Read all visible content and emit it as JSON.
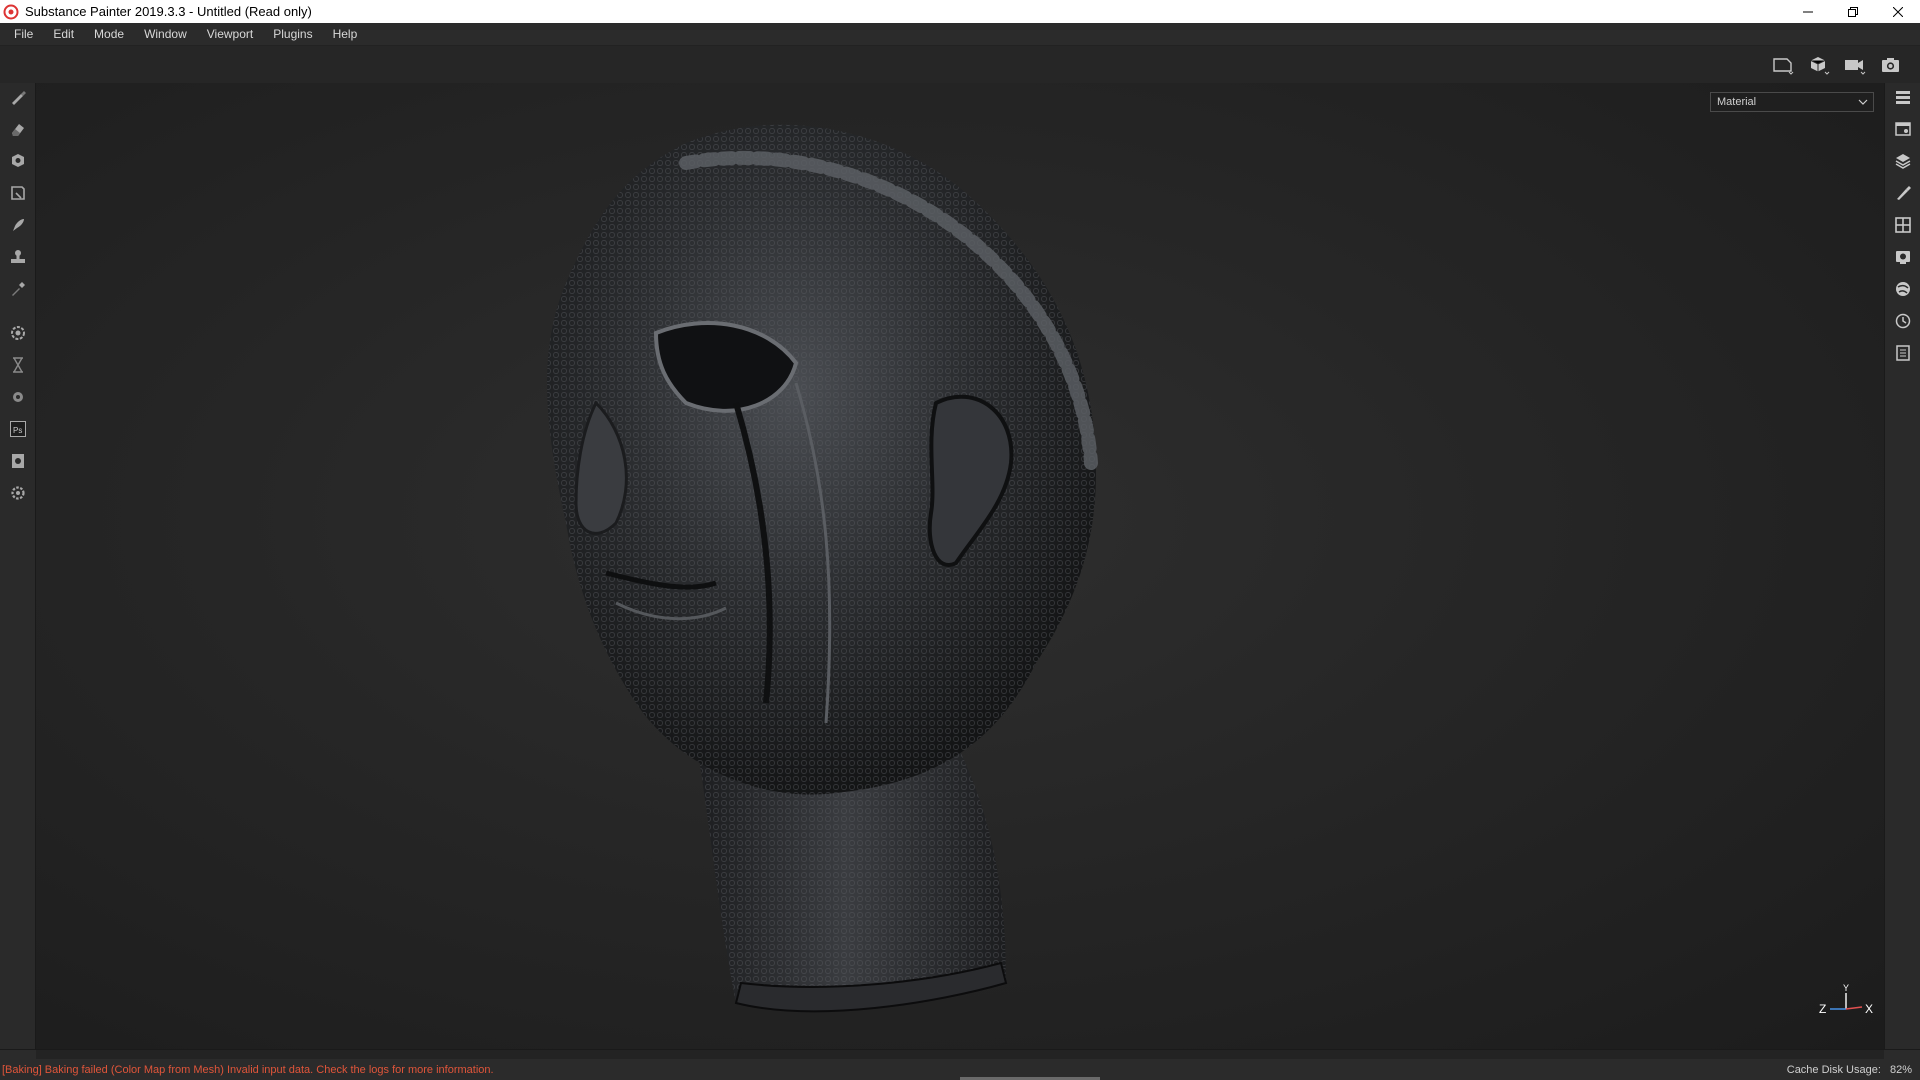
{
  "window": {
    "title": "Substance Painter 2019.3.3 - Untitled (Read only)",
    "minimize_icon": "minimize-icon",
    "restore_icon": "restore-icon",
    "close_icon": "close-icon"
  },
  "menu": {
    "items": [
      "File",
      "Edit",
      "Mode",
      "Window",
      "Viewport",
      "Plugins",
      "Help"
    ]
  },
  "viewport_toolbar": {
    "icons": [
      "2d-view-icon",
      "3d-view-icon",
      "camera-icon",
      "screenshot-icon"
    ]
  },
  "left_toolbar": {
    "icons": [
      "paint-brush-icon",
      "eraser-icon",
      "projection-icon",
      "polygon-fill-icon",
      "smudge-icon",
      "clone-stamp-icon",
      "color-picker-icon",
      "settings-icon",
      "hourglass-icon",
      "bake-icon",
      "photoshop-icon",
      "export-icon",
      "gear-icon"
    ]
  },
  "right_dock": {
    "icons": [
      "texture-set-list-icon",
      "texture-set-settings-icon",
      "layers-icon",
      "properties-icon",
      "display-settings-icon",
      "viewer-settings-icon",
      "shelf-icon",
      "history-icon",
      "log-icon"
    ]
  },
  "viewport": {
    "view_mode": "Material",
    "axis_labels": {
      "z": "Z",
      "y": "Y",
      "x": "X"
    }
  },
  "status": {
    "message": "[Baking] Baking failed (Color Map from Mesh) Invalid input data. Check the logs for more information.",
    "cache_label": "Cache Disk Usage:",
    "cache_value": "82%"
  },
  "colors": {
    "error_text": "#e0553a",
    "panel_bg": "#2a2a2a",
    "viewport_bg": "#262626"
  }
}
